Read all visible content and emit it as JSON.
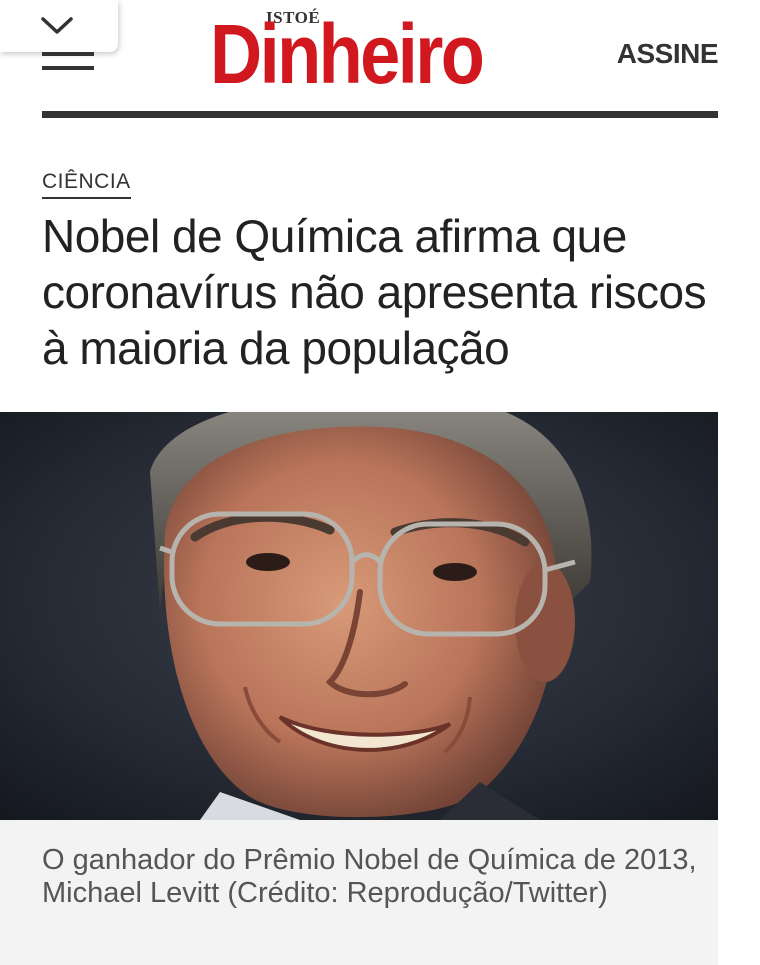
{
  "header": {
    "logo_small": "ISTOÉ",
    "logo_main": "Dinheiro",
    "subscribe_label": "ASSINE",
    "collapse_icon": "chevron-down-icon",
    "menu_icon": "hamburger-menu-icon"
  },
  "article": {
    "category": "CIÊNCIA",
    "headline": "Nobel de Química afirma que coronavírus não apresenta riscos à maioria da população",
    "caption": "O ganhador do Prêmio Nobel de Química de 2013, Michael Levitt (Crédito: Reprodução/Twitter)"
  },
  "colors": {
    "brand_red": "#d0181e",
    "text_dark": "#222222",
    "rule": "#333333",
    "caption_bg": "#f3f3f3"
  }
}
